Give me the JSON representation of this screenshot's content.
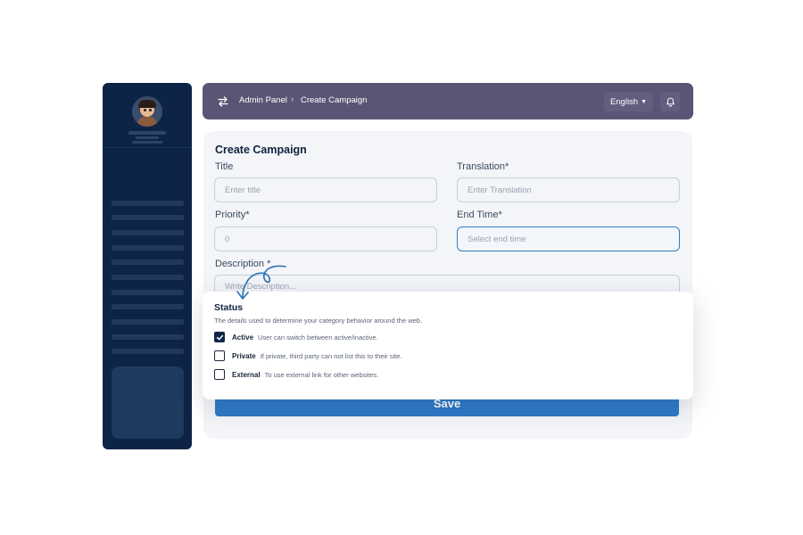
{
  "header": {
    "breadcrumb": [
      "Admin Panel",
      "Create Campaign"
    ],
    "language": "English"
  },
  "form": {
    "title": "Create Campaign",
    "fields": {
      "title": {
        "label": "Title",
        "placeholder": "Enter title"
      },
      "translation": {
        "label": "Translation*",
        "placeholder": "Enter Translation"
      },
      "priority": {
        "label": "Priority*",
        "placeholder": "0"
      },
      "end_time": {
        "label": "End Time*",
        "placeholder": "Select end time"
      },
      "description": {
        "label": "Description *",
        "placeholder": "Write Description..."
      }
    },
    "save_label": "Save"
  },
  "status": {
    "title": "Status",
    "description": "The details used to determine your category behavior around the web.",
    "options": [
      {
        "name": "Active",
        "text": "User can switch between active/inactive.",
        "checked": true
      },
      {
        "name": "Private",
        "text": "If private, third party can not list this to their site.",
        "checked": false
      },
      {
        "name": "External",
        "text": "To use external link for other websites.",
        "checked": false
      }
    ]
  },
  "colors": {
    "sidebar": "#0e2446",
    "header": "#5b5475",
    "accent": "#2d7ac7"
  }
}
